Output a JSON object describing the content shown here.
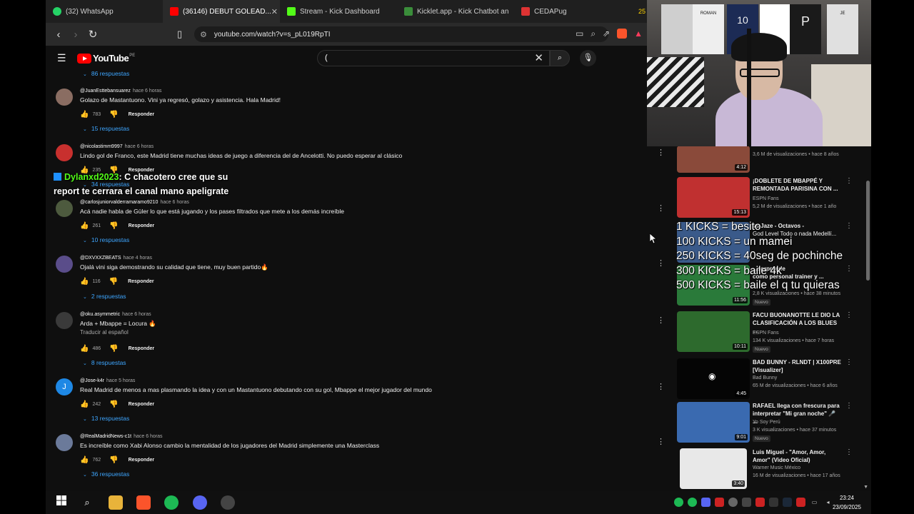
{
  "tabs": [
    {
      "label": "(32) WhatsApp",
      "color": "#25d366"
    },
    {
      "label": "(36146) DEBUT GOLEAD...",
      "color": "#ff0000"
    },
    {
      "label": "Stream - Kick Dashboard",
      "color": "#53fc18"
    },
    {
      "label": "Kicklet.app - Kick Chatbot an",
      "color": "#3a8d3a"
    },
    {
      "label": "CEDAPug",
      "color": "#d33"
    }
  ],
  "tab_overflow": "25",
  "address": {
    "url": "youtube.com/watch?v=s_pL019RpTI"
  },
  "youtube": {
    "logo_text": "YouTube",
    "logo_country": "PE",
    "search_value": "(",
    "top_replies": "86 respuestas"
  },
  "comments": [
    {
      "initial": "",
      "user": "@JuanEsttebansuarez",
      "ago": "hace 6 horas",
      "text": "Golazo de Mastantuono. Vini ya regresó, golazo y asistencia. Hala Madrid!",
      "likes": "783",
      "respond": "Responder",
      "replies": "15 respuestas",
      "avatar_color": "#8a6d62"
    },
    {
      "initial": "",
      "user": "@nicolastimm9997",
      "ago": "hace 6 horas",
      "text": "Lindo gol de Franco, este Madrid tiene muchas ideas de juego a diferencia del de Ancelotti. No puedo esperar al clásico",
      "likes": "235",
      "respond": "Responder",
      "replies": "34 respuestas",
      "avatar_color": "#c8302e"
    },
    {
      "initial": "",
      "user": "@carlosjuniorvalderramaramo9210",
      "ago": "hace 6 horas",
      "text": "Acá nadie habla de Güler lo que está jugando y los pases filtrados que mete a los demás increíble",
      "likes": "261",
      "respond": "Responder",
      "replies": "10 respuestas",
      "avatar_color": "#4d5a3e"
    },
    {
      "initial": "",
      "user": "@DXVXXZBEATS",
      "ago": "hace 4 horas",
      "text": "Ojalá vini siga demostrando su calidad que tiene, muy buen partido🔥",
      "likes": "116",
      "respond": "Responder",
      "replies": "2 respuestas",
      "avatar_color": "#5a4d8a"
    },
    {
      "initial": "",
      "user": "@oku.asymmetric",
      "ago": "hace 6 horas",
      "text": "Arda + Mbappe = Locura 🔥",
      "translate": "Traducir al español",
      "likes": "486",
      "respond": "Responder",
      "replies": "8 respuestas",
      "avatar_color": "#3a3a3a"
    },
    {
      "initial": "J",
      "user": "@Jose-k4r",
      "ago": "hace 5 horas",
      "text": "Real Madrid de menos a mas plasmando la idea y con un Mastantuono debutando con su gol, Mbappe el mejor jugador del mundo",
      "likes": "242",
      "respond": "Responder",
      "replies": "13 respuestas",
      "avatar_color": "#1e88e5"
    },
    {
      "initial": "",
      "user": "@RealMadridNews-c1t",
      "ago": "hace 6 horas",
      "text": "Es increíble como Xabi Alonso cambio la mentalidad de los jugadores del Madrid simplemente una Masterclass",
      "likes": "762",
      "respond": "Responder",
      "replies": "36 respuestas",
      "avatar_color": "#6b7a9a"
    }
  ],
  "chat_overlay": {
    "user": "Dylanxd2023",
    "message": ": C chacotero cree que su report te cerrara el canal mano apeligrate"
  },
  "kicks_overlay": [
    "1 KICKS = besito",
    "100 KICKS = un mamei",
    "250 KICKS = 40seg de pochinche",
    "300 KICKS = baile 4k",
    "500 KICKS = baile el q tu quieras"
  ],
  "sidebar_videos": [
    {
      "title": "",
      "channel": "",
      "stats": "3,6 M de visualizaciones • hace 8 años",
      "duration": "4:12",
      "new": "",
      "thumb": "#8a4a3a"
    },
    {
      "title": "¡DOBLETE DE MBAPPÉ Y REMONTADA PARISINA CON ...",
      "channel": "ESPN Fans",
      "stats": "5,2 M de visualizaciones • hace 1 año",
      "duration": "15:13",
      "new": "",
      "thumb": "#c03030"
    },
    {
      "title": "",
      "channel": "",
      "stats": "",
      "duration": "",
      "new": "",
      "thumb": "#3a5a8a"
    },
    {
      "title": "",
      "channel": "",
      "stats": "2,8 K visualizaciones • hace 38 minutos",
      "duration": "11:56",
      "new": "Nuevo",
      "thumb": "#2a7a3a"
    },
    {
      "title": "FACU BUONANOTTE LE DIO LA CLASIFICACIÓN A LOS BLUES ...",
      "channel": "ESPN Fans",
      "stats": "134 K visualizaciones • hace 7 horas",
      "duration": "10:11",
      "new": "Nuevo",
      "thumb": "#2d6a2d"
    },
    {
      "title": "BAD BUNNY - RLNDT | X100PRE [Visualizer]",
      "channel": "Bad Bunny",
      "stats": "65 M de visualizaciones • hace 6 años",
      "duration": "4:45",
      "new": "",
      "thumb": "#050505"
    },
    {
      "title": "RAFAEL llega con frescura para interpretar \"Mi gran noche\" 🎤 ...",
      "channel": "Yo Soy Perú",
      "stats": "3 K visualizaciones • hace 37 minutos",
      "duration": "9:01",
      "new": "Nuevo",
      "thumb": "#3a6ab0"
    },
    {
      "title": "Luis Miguel - \"Amor, Amor, Amor\" (Video Oficial)",
      "channel": "Warner Music México",
      "stats": "16 M de visualizaciones • hace 17 años",
      "duration": "3:40",
      "new": "",
      "thumb": "#e8e8e8"
    }
  ],
  "sidebar_partial": {
    "line1": "vs Jaze - Octavos -",
    "line2": "God Level Todo o nada Medellí...",
    "line3": "...sorprende",
    "line4": "como personal trainer y ..."
  },
  "cam_jerseys": [
    "ROMAN",
    "10",
    "P",
    "JE"
  ],
  "taskbar": {
    "time": "23:24",
    "date": "23/09/2025"
  }
}
